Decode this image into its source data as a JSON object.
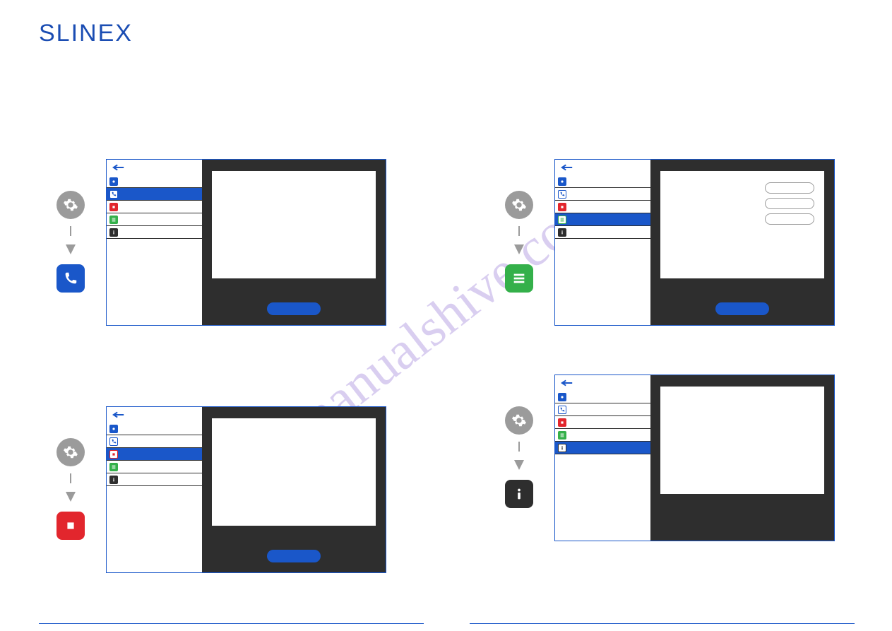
{
  "brand": "SLINEX",
  "watermark": "manualshive.com",
  "menu": {
    "items": [
      {
        "name": "settings"
      },
      {
        "name": "call"
      },
      {
        "name": "record"
      },
      {
        "name": "list"
      },
      {
        "name": "info"
      }
    ]
  },
  "sections": [
    {
      "id": "call",
      "selected_index": 1,
      "target_icon": "phone",
      "target_color": "#1a57c9"
    },
    {
      "id": "list",
      "selected_index": 3,
      "target_icon": "list",
      "target_color": "#34b04a"
    },
    {
      "id": "record",
      "selected_index": 2,
      "target_icon": "stop",
      "target_color": "#e2262d"
    },
    {
      "id": "info",
      "selected_index": 4,
      "target_icon": "info",
      "target_color": "#2e2e2e"
    }
  ],
  "colors": {
    "brand_blue": "#1b4db3",
    "accent_blue": "#1a57c9",
    "green": "#34b04a",
    "red": "#e2262d",
    "dark": "#2e2e2e",
    "gray": "#9b9b9b"
  }
}
